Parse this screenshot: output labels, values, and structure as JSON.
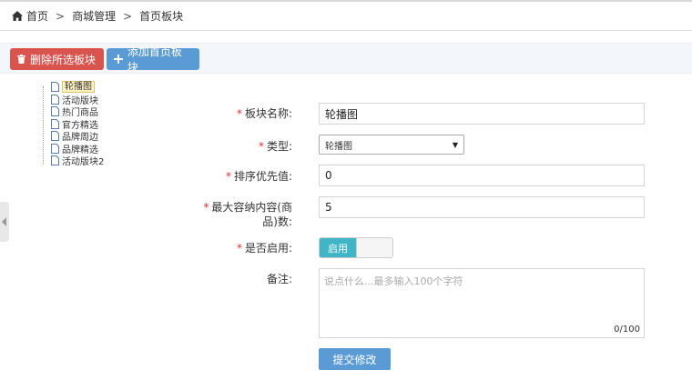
{
  "breadcrumb": {
    "home": "首页",
    "sep": ">",
    "level2": "商城管理",
    "level3": "首页板块"
  },
  "toolbar": {
    "delete_label": "删除所选板块",
    "add_label": "添加首页板块"
  },
  "tree": {
    "items": [
      "轮播图",
      "活动版块",
      "热门商品",
      "官方精选",
      "品牌周边",
      "品牌精选",
      "活动版块2"
    ],
    "selected": "轮播图"
  },
  "form": {
    "name": {
      "label": "板块名称:",
      "value": "轮播图"
    },
    "type": {
      "label": "类型:",
      "value": "轮播图"
    },
    "priority": {
      "label": "排序优先值:",
      "value": "0"
    },
    "max_items": {
      "label_line1": "最大容纳内容(商",
      "label_line2": "品)数:",
      "value": "5"
    },
    "enabled": {
      "label": "是否启用:",
      "on_label": "启用"
    },
    "remark": {
      "label": "备注:",
      "placeholder": "说点什么...最多输入100个字符",
      "counter": "0/100"
    },
    "required_mark": "*",
    "submit_label": "提交修改"
  },
  "colors": {
    "danger": "#d9534f",
    "primary": "#5b9bd5",
    "toggle_on": "#3fb5c6",
    "required": "#e02f2f"
  }
}
